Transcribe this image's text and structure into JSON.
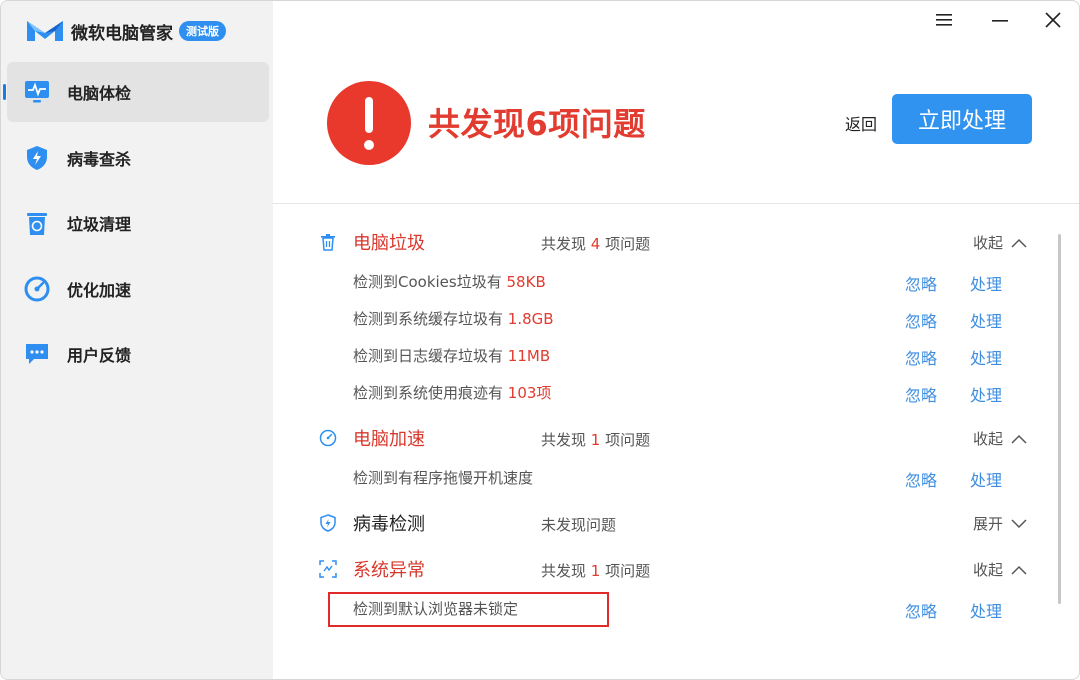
{
  "app": {
    "title": "微软电脑管家",
    "badge": "测试版",
    "colors": {
      "accent": "#2f93ef",
      "alert": "#e8392c",
      "problem_text": "#e23b2f",
      "link": "#3f8fe0"
    }
  },
  "window_controls": {
    "menu_icon": "hamburger-icon",
    "minimize_icon": "minimize-icon",
    "close_icon": "close-icon"
  },
  "sidebar": {
    "items": [
      {
        "label": "电脑体检",
        "icon": "monitor-pulse-icon",
        "active": true
      },
      {
        "label": "病毒查杀",
        "icon": "shield-bolt-icon",
        "active": false
      },
      {
        "label": "垃圾清理",
        "icon": "recycle-bin-icon",
        "active": false
      },
      {
        "label": "优化加速",
        "icon": "speedometer-icon",
        "active": false
      },
      {
        "label": "用户反馈",
        "icon": "chat-bubble-icon",
        "active": false
      }
    ]
  },
  "header": {
    "headline": "共发现6项问题",
    "back_label": "返回",
    "action_label": "立即处理",
    "alert_icon": "exclamation-circle-icon"
  },
  "actions": {
    "ignore": "忽略",
    "fix": "处理"
  },
  "sections": [
    {
      "title": "电脑垃圾",
      "icon": "trash-icon",
      "summary_prefix": "共发现",
      "summary_count": "4",
      "summary_suffix": "项问题",
      "toggle": "收起",
      "items": [
        {
          "text": "检测到Cookies垃圾有",
          "value": "58KB"
        },
        {
          "text": "检测到系统缓存垃圾有",
          "value": "1.8GB"
        },
        {
          "text": "检测到日志缓存垃圾有",
          "value": "11MB"
        },
        {
          "text": "检测到系统使用痕迹有",
          "value": "103项"
        }
      ]
    },
    {
      "title": "电脑加速",
      "icon": "gauge-icon",
      "summary_prefix": "共发现",
      "summary_count": "1",
      "summary_suffix": "项问题",
      "toggle": "收起",
      "items": [
        {
          "text": "检测到有程序拖慢开机速度",
          "value": ""
        }
      ]
    },
    {
      "title": "病毒检测",
      "icon": "shield-icon",
      "summary_text": "未发现问题",
      "toggle": "展开",
      "items": []
    },
    {
      "title": "系统异常",
      "icon": "scan-icon",
      "summary_prefix": "共发现",
      "summary_count": "1",
      "summary_suffix": "项问题",
      "toggle": "收起",
      "items": [
        {
          "text": "检测到默认浏览器未锁定",
          "value": ""
        }
      ]
    }
  ]
}
